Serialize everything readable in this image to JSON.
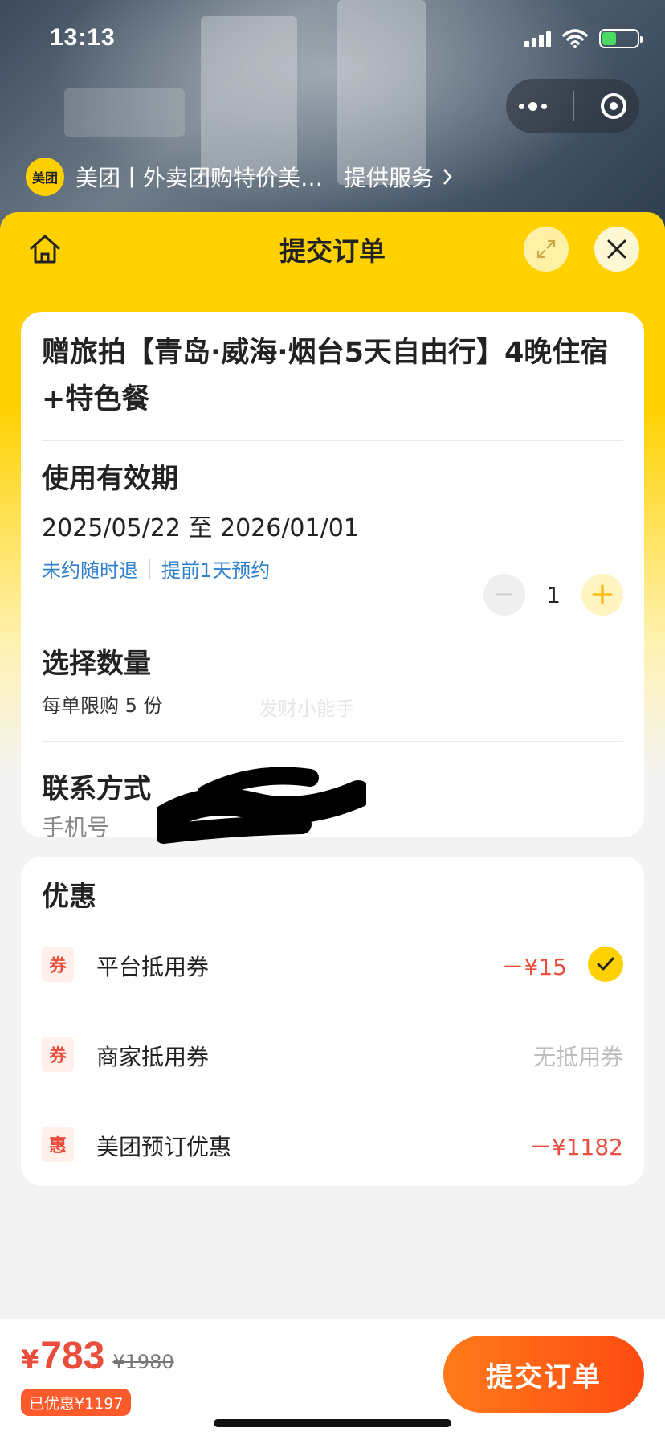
{
  "status_bar": {
    "time": "13:13"
  },
  "mini_program": {
    "name": "美团丨外卖团购特价美…",
    "service_label": "提供服务",
    "logo_text": "美团"
  },
  "sheet": {
    "title": "提交订单"
  },
  "product": {
    "title": "赠旅拍【青岛·威海·烟台5天自由行】4晚住宿+特色餐",
    "validity_label": "使用有效期",
    "validity_dates": "2025/05/22 至 2026/01/01",
    "tags": [
      "未约随时退",
      "提前1天预约"
    ]
  },
  "quantity": {
    "label": "选择数量",
    "value": "1",
    "limit_text": "每单限购 5 份",
    "watermark": "发财小能手"
  },
  "contact": {
    "label": "联系方式",
    "phone_label": "手机号"
  },
  "discounts": {
    "title": "优惠",
    "rows": [
      {
        "tag": "券",
        "name": "平台抵用券",
        "amount": "－¥15",
        "checked": true
      },
      {
        "tag": "券",
        "name": "商家抵用券",
        "amount": "无抵用券",
        "checked": false
      },
      {
        "tag": "惠",
        "name": "美团预订优惠",
        "amount": "－¥1182",
        "checked": false
      }
    ]
  },
  "footer": {
    "currency": "¥",
    "price": "783",
    "original_price": "¥1980",
    "saved_text": "已优惠¥1197",
    "submit_label": "提交订单"
  },
  "colors": {
    "brand_yellow": "#ffd100",
    "accent_red": "#e94e3c",
    "submit_orange": "#ff5a1a",
    "link_blue": "#2f7fcf"
  }
}
